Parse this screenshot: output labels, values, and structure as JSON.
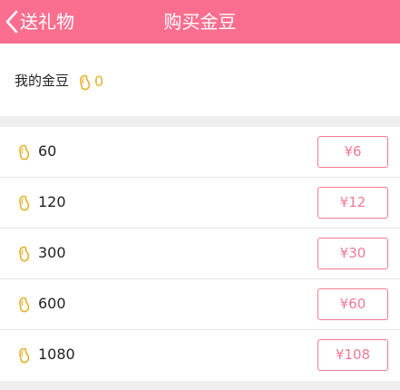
{
  "colors": {
    "header_bg": "#fc6e8f",
    "accent": "#f07a96",
    "bean": "#e5b12d"
  },
  "header": {
    "back_label": "送礼物",
    "title": "购买金豆",
    "back_icon": "chevron-left-icon"
  },
  "balance": {
    "label": "我的金豆",
    "icon": "gold-bean-icon",
    "value": "0"
  },
  "packages": [
    {
      "amount": "60",
      "price": "¥6"
    },
    {
      "amount": "120",
      "price": "¥12"
    },
    {
      "amount": "300",
      "price": "¥30"
    },
    {
      "amount": "600",
      "price": "¥60"
    },
    {
      "amount": "1080",
      "price": "¥108"
    }
  ]
}
